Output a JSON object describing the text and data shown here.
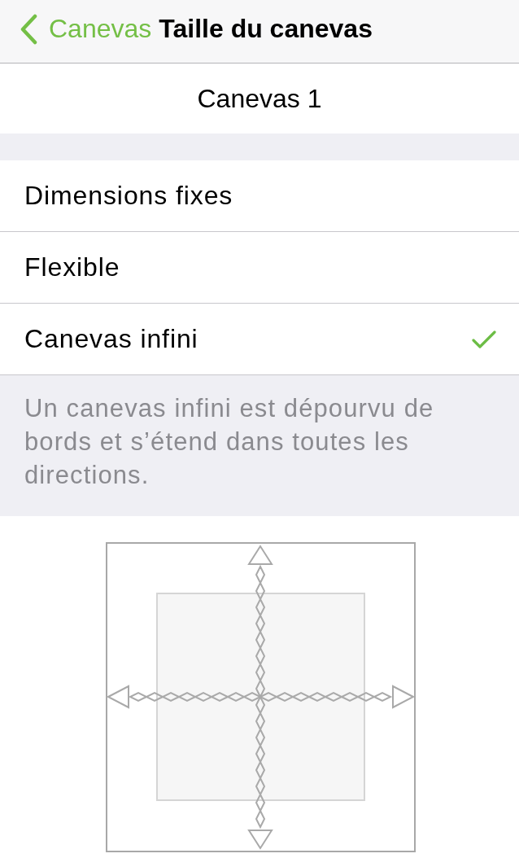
{
  "nav": {
    "back_label": "Canevas",
    "title": "Taille du canevas"
  },
  "canvas_name": "Canevas 1",
  "size_options": [
    {
      "label": "Dimensions fixes",
      "selected": false
    },
    {
      "label": "Flexible",
      "selected": false
    },
    {
      "label": "Canevas infini",
      "selected": true
    }
  ],
  "footer_note": "Un canevas infini est dépourvu de bords et s’étend dans toutes les directions."
}
